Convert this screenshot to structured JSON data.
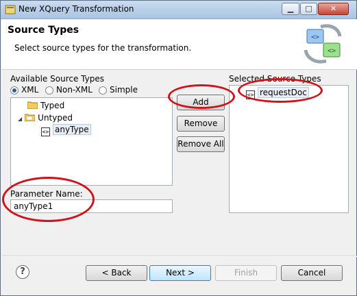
{
  "window": {
    "title": "New XQuery Transformation"
  },
  "header": {
    "title": "Source Types",
    "subtitle": "Select source types for the transformation."
  },
  "available": {
    "label": "Available Source Types",
    "radios": [
      {
        "label": "XML",
        "selected": true
      },
      {
        "label": "Non-XML",
        "selected": false
      },
      {
        "label": "Simple",
        "selected": false
      }
    ],
    "tree": [
      {
        "label": "Typed",
        "icon": "folder-icon"
      },
      {
        "label": "Untyped",
        "icon": "folder-icon",
        "expanded": true
      },
      {
        "label": "anyType",
        "icon": "xml-type-icon",
        "selected": true
      }
    ]
  },
  "param": {
    "label": "Parameter Name:",
    "value": "anyType1"
  },
  "middle_buttons": {
    "add": "Add",
    "remove": "Remove",
    "remove_all": "Remove All"
  },
  "selected": {
    "label": "Selected Source Types",
    "items": [
      {
        "label": "requestDoc",
        "icon": "xml-type-icon"
      }
    ]
  },
  "footer": {
    "back": "< Back",
    "next": "Next >",
    "finish": "Finish",
    "cancel": "Cancel"
  },
  "colors": {
    "highlight_ellipse": "#d0121a",
    "titlebar": "#bcd2ea"
  }
}
